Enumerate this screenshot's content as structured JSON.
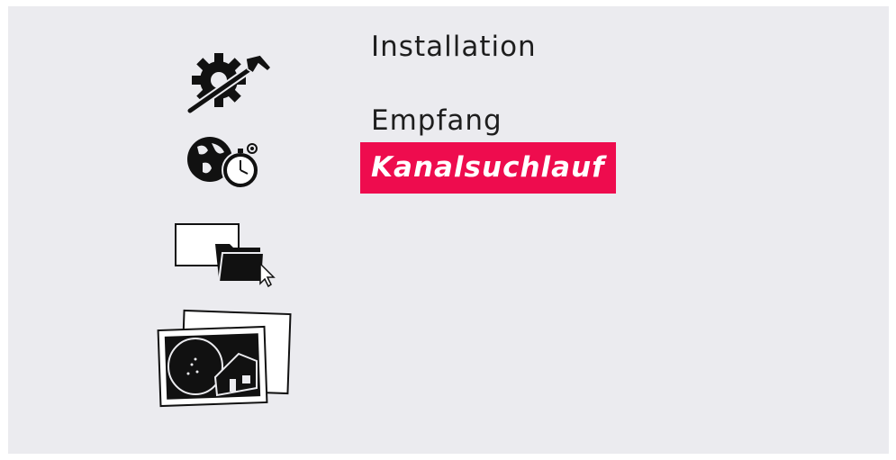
{
  "menu": {
    "items": [
      {
        "label": "Installation",
        "icon": "gear-hammer-icon",
        "selected": false
      },
      {
        "label": "Empfang",
        "icon": "globe-timer-icon",
        "selected": false
      },
      {
        "label": "Kanalsuchlauf",
        "icon": "",
        "selected": true
      }
    ]
  },
  "icons": [
    {
      "name": "gear-hammer-icon"
    },
    {
      "name": "globe-timer-icon"
    },
    {
      "name": "media-folder-icon"
    },
    {
      "name": "satellite-photos-icon"
    }
  ],
  "colors": {
    "background": "#ebebef",
    "highlight": "#ee0c4e",
    "text": "#1e1e1e",
    "selected_text": "#ffffff"
  }
}
